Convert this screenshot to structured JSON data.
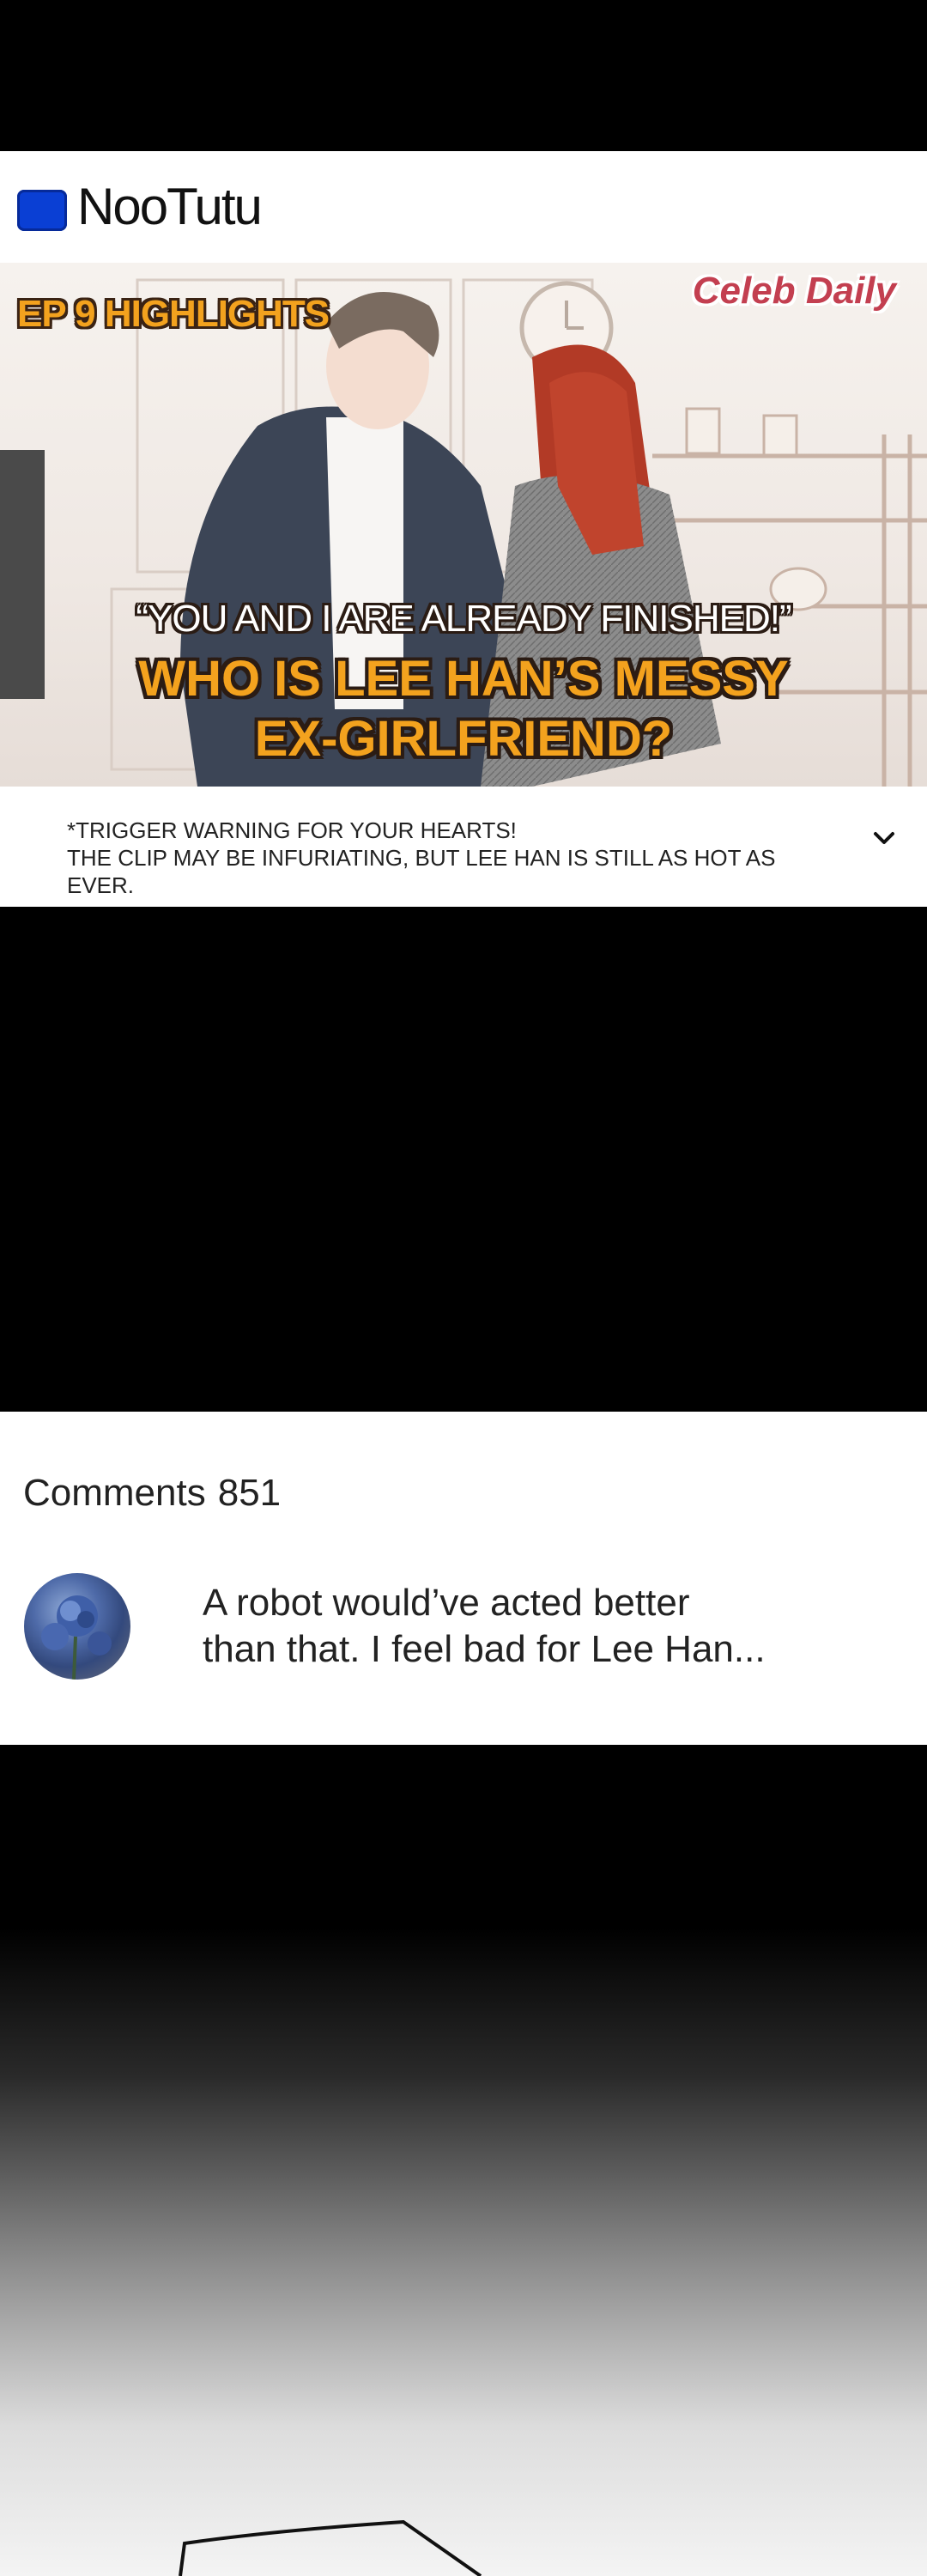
{
  "brand": {
    "name": "NooTutu",
    "color": "#0a3fd4"
  },
  "video": {
    "episode_label": "EP 9 HIGHLIGHTS",
    "channel_name": "Celeb Daily",
    "quote": "“YOU AND I ARE ALREADY FINISHED!”",
    "headline_line1": "WHO IS LEE HAN’S MESSY",
    "headline_line2": "EX-GIRLFRIEND?",
    "description_line1": "*TRIGGER WARNING FOR YOUR HEARTS!",
    "description_line2": "THE CLIP MAY BE INFURIATING, BUT LEE HAN IS STILL AS HOT AS EVER.",
    "expand_icon": "chevron-down-icon"
  },
  "comments": {
    "label": "Comments",
    "count": "851",
    "items": [
      {
        "avatar_icon": "blue-rose-avatar",
        "text_line1": "A robot would’ve acted better",
        "text_line2": "than that. I feel bad for Lee Han..."
      }
    ]
  },
  "colors": {
    "headline": "#f3a21e",
    "channel": "#c33f50",
    "background": "#000000"
  }
}
